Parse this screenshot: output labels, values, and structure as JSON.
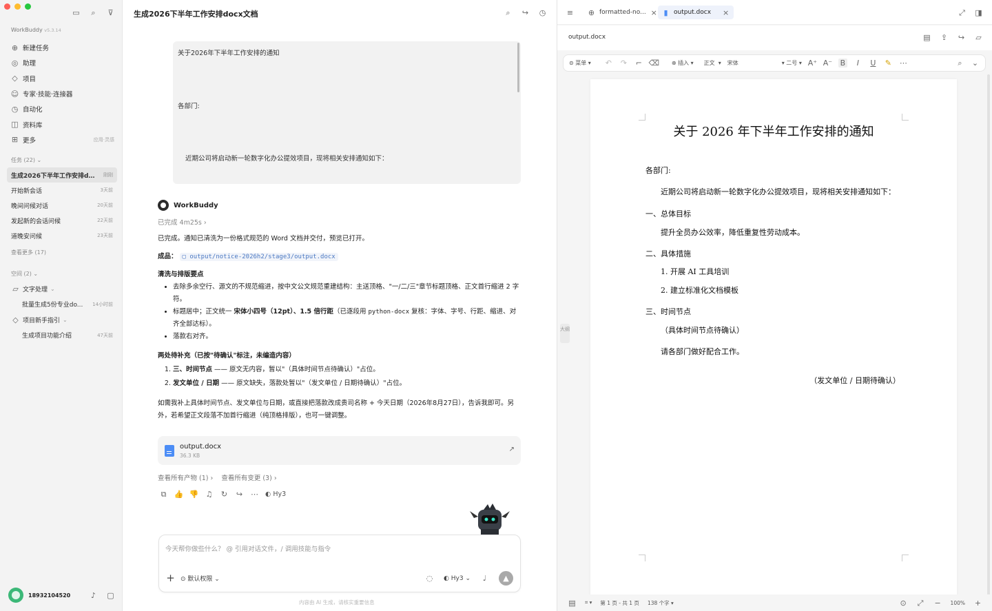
{
  "sidebar": {
    "brand": "WorkBuddy",
    "version": "v5.3.14",
    "nav": [
      {
        "label": "新建任务",
        "icon": "plus-circle-icon"
      },
      {
        "label": "助理",
        "icon": "assistant-icon"
      },
      {
        "label": "项目",
        "icon": "project-icon"
      },
      {
        "label": "专家·技能·连接器",
        "icon": "expert-icon"
      },
      {
        "label": "自动化",
        "icon": "automation-icon"
      },
      {
        "label": "资料库",
        "icon": "library-icon"
      },
      {
        "label": "更多",
        "icon": "grid-icon",
        "hint": "应用·灵感"
      }
    ],
    "tasks_header": "任务 (22)",
    "tasks": [
      {
        "title": "生成2026下半年工作安排d...",
        "time": "刚刚"
      },
      {
        "title": "开始新会话",
        "time": "3天前"
      },
      {
        "title": "晚间问候对话",
        "time": "20天前"
      },
      {
        "title": "发起新的会话问候",
        "time": "22天前"
      },
      {
        "title": "道晚安问候",
        "time": "23天前"
      }
    ],
    "view_more": "查看更多 (17)",
    "spaces_header": "空间 (2)",
    "spaces": [
      {
        "label": "文字处理",
        "time": "",
        "indent": false
      },
      {
        "label": "批量生成5份专业do...",
        "time": "14小时前",
        "indent": true
      },
      {
        "label": "项目新手指引",
        "time": "",
        "indent": false
      },
      {
        "label": "生成项目功能介绍",
        "time": "47天前",
        "indent": true
      }
    ],
    "user": "18932104520"
  },
  "chat": {
    "title": "生成2026下半年工作安排docx文档",
    "quote": [
      "关于2026年下半年工作安排的通知",
      "各部门:",
      "近期公司将启动新一轮数字化办公提效项目，现将相关安排通知如下："
    ],
    "assistant_name": "WorkBuddy",
    "status": "已完成 4m25s",
    "intro": "已完成。通知已清洗为一份格式规范的 Word 文档并交付，预览已打开。",
    "output_label": "成品：",
    "output_path": "output/notice-2026h2/stage3/output.docx",
    "clean_heading": "清洗与排版要点",
    "bullet1": "去除多余空行、源文的不规范缩进，按中文公文规范重建结构：主送顶格、\"一/二/三\"章节标题顶格、正文首行缩进 2 字符。",
    "bullet2_a": "标题居中；正文统一 ",
    "bullet2_b": "宋体小四号（12pt）、1.5 倍行距",
    "bullet2_c": "（已逐段用 ",
    "bullet2_code": "python-docx",
    "bullet2_d": " 复核：字体、字号、行距、缩进、对齐全部达标）。",
    "bullet3": "落款右对齐。",
    "pending_heading": "两处待补充（已按\"待确认\"标注，未编造内容）",
    "item1_b": "三、时间节点",
    "item1_t": " —— 原文无内容，暂以\"（具体时间节点待确认）\"占位。",
    "item2_b": "发文单位 / 日期",
    "item2_t": " —— 原文缺失，落款处暂以\"（发文单位 / 日期待确认）\"占位。",
    "closing": "如需我补上具体时间节点、发文单位与日期，或直接把落款改成贵司名称 + 今天日期（2026年8月27日），告诉我即可。另外，若希望正文段落不加首行缩进（纯顶格排版），也可一键调整。",
    "file_name": "output.docx",
    "file_size": "36.3 KB",
    "link_products": "查看所有产物 (1)",
    "link_changes": "查看所有变更 (3)",
    "model": "Hy3",
    "input_placeholder": "今天帮你做些什么？ @ 引用对话文件，/ 调用技能与指令",
    "permission": "默认权限",
    "disclaimer": "内容由 AI 生成，请核实重要信息"
  },
  "viewer": {
    "tabs": [
      {
        "label": "formatted-no...",
        "active": false
      },
      {
        "label": "output.docx",
        "active": true
      }
    ],
    "file_name": "output.docx",
    "toolbar": {
      "menu": "菜单",
      "insert": "插入",
      "style": "正文",
      "font": "宋体",
      "size": "二号"
    },
    "outline": "大纲",
    "doc": {
      "title": "关于 2026 年下半年工作安排的通知",
      "addressee": "各部门:",
      "intro": "近期公司将启动新一轮数字化办公提效项目，现将相关安排通知如下：",
      "s1": "一、总体目标",
      "s1p": "提升全员办公效率，降低重复性劳动成本。",
      "s2": "二、具体措施",
      "s2a": "1. 开展 AI 工具培训",
      "s2b": "2. 建立标准化文档模板",
      "s3": "三、时间节点",
      "s3p": "（具体时间节点待确认）",
      "ask": "请各部门做好配合工作。",
      "sign": "（发文单位 / 日期待确认）"
    },
    "status": {
      "pages": "第 1 页 - 共 1 页",
      "words": "138 个字",
      "zoom": "100%"
    }
  }
}
